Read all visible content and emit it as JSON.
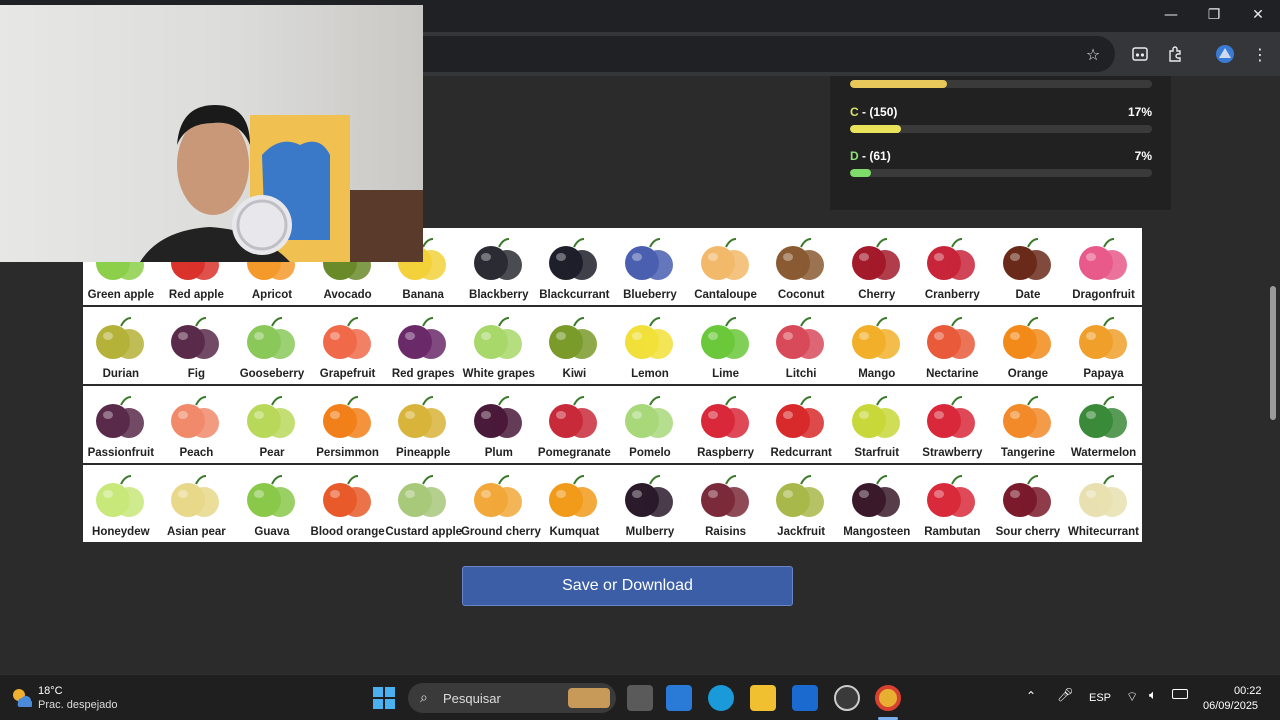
{
  "browser": {
    "window_controls": {
      "minimize": "—",
      "maximize": "❐",
      "close": "✕"
    },
    "toolbar_icons": [
      "star-icon",
      "reading-mode-icon",
      "extensions-icon",
      "profile-icon",
      "menu-icon"
    ]
  },
  "results": [
    {
      "letter": "C",
      "count": "- (150)",
      "percent": "17%",
      "fill": 0.17,
      "color": "#e8e35a"
    },
    {
      "letter": "D",
      "count": "- (61)",
      "percent": "7%",
      "fill": 0.07,
      "color": "#7edc6a"
    }
  ],
  "top_bar_fill": 0.32,
  "fruits": [
    [
      "Green apple",
      "Red apple",
      "Apricot",
      "Avocado",
      "Banana",
      "Blackberry",
      "Blackcurrant",
      "Blueberry",
      "Cantaloupe",
      "Coconut",
      "Cherry",
      "Cranberry",
      "Date",
      "Dragonfruit"
    ],
    [
      "Durian",
      "Fig",
      "Gooseberry",
      "Grapefruit",
      "Red grapes",
      "White grapes",
      "Kiwi",
      "Lemon",
      "Lime",
      "Litchi",
      "Mango",
      "Nectarine",
      "Orange",
      "Papaya"
    ],
    [
      "Passionfruit",
      "Peach",
      "Pear",
      "Persimmon",
      "Pineapple",
      "Plum",
      "Pomegranate",
      "Pomelo",
      "Raspberry",
      "Redcurrant",
      "Starfruit",
      "Strawberry",
      "Tangerine",
      "Watermelon"
    ],
    [
      "Honeydew",
      "Asian pear",
      "Guava",
      "Blood orange",
      "Custard apple",
      "Ground cherry",
      "Kumquat",
      "Mulberry",
      "Raisins",
      "Jackfruit",
      "Mangosteen",
      "Rambutan",
      "Sour cherry",
      "Whitecurrant"
    ]
  ],
  "fruit_colors": [
    [
      "#8ccf4a",
      "#d9332b",
      "#f39a2b",
      "#6a8a2a",
      "#f2d13a",
      "#2b2b34",
      "#1f1f2b",
      "#4a5fb0",
      "#f2b96a",
      "#8a5a32",
      "#a31a2a",
      "#c8243a",
      "#6a2a1a",
      "#e85a8a"
    ],
    [
      "#b5b23a",
      "#5a2a4a",
      "#8ac85a",
      "#f06a4a",
      "#6a2a6a",
      "#a8d86a",
      "#7a9a2a",
      "#f2e03a",
      "#6ac83a",
      "#d84a5a",
      "#f2b02a",
      "#e85a3a",
      "#f28a1a",
      "#f0a02a"
    ],
    [
      "#5a2a4a",
      "#f08a6a",
      "#b8d85a",
      "#f2801a",
      "#d8b43a",
      "#4a1a3a",
      "#c82a3a",
      "#a8d87a",
      "#d8283a",
      "#d82a2a",
      "#c8d83a",
      "#d8283a",
      "#f28a2a",
      "#3a8a3a"
    ],
    [
      "#c8e87a",
      "#e8d88a",
      "#8ac84a",
      "#e85a2a",
      "#a8c87a",
      "#f2a83a",
      "#f29a1a",
      "#2a1a2a",
      "#7a2a3a",
      "#a8b84a",
      "#3a1a2a",
      "#d82a3a",
      "#7a1a2a",
      "#e8e0b0"
    ]
  ],
  "save_button": "Save or Download",
  "taskbar": {
    "temperature": "18°C",
    "weather": "Prac. despejado",
    "search_placeholder": "Pesquisar",
    "language": "ESP",
    "time": "00:22",
    "date": "06/09/2025"
  }
}
